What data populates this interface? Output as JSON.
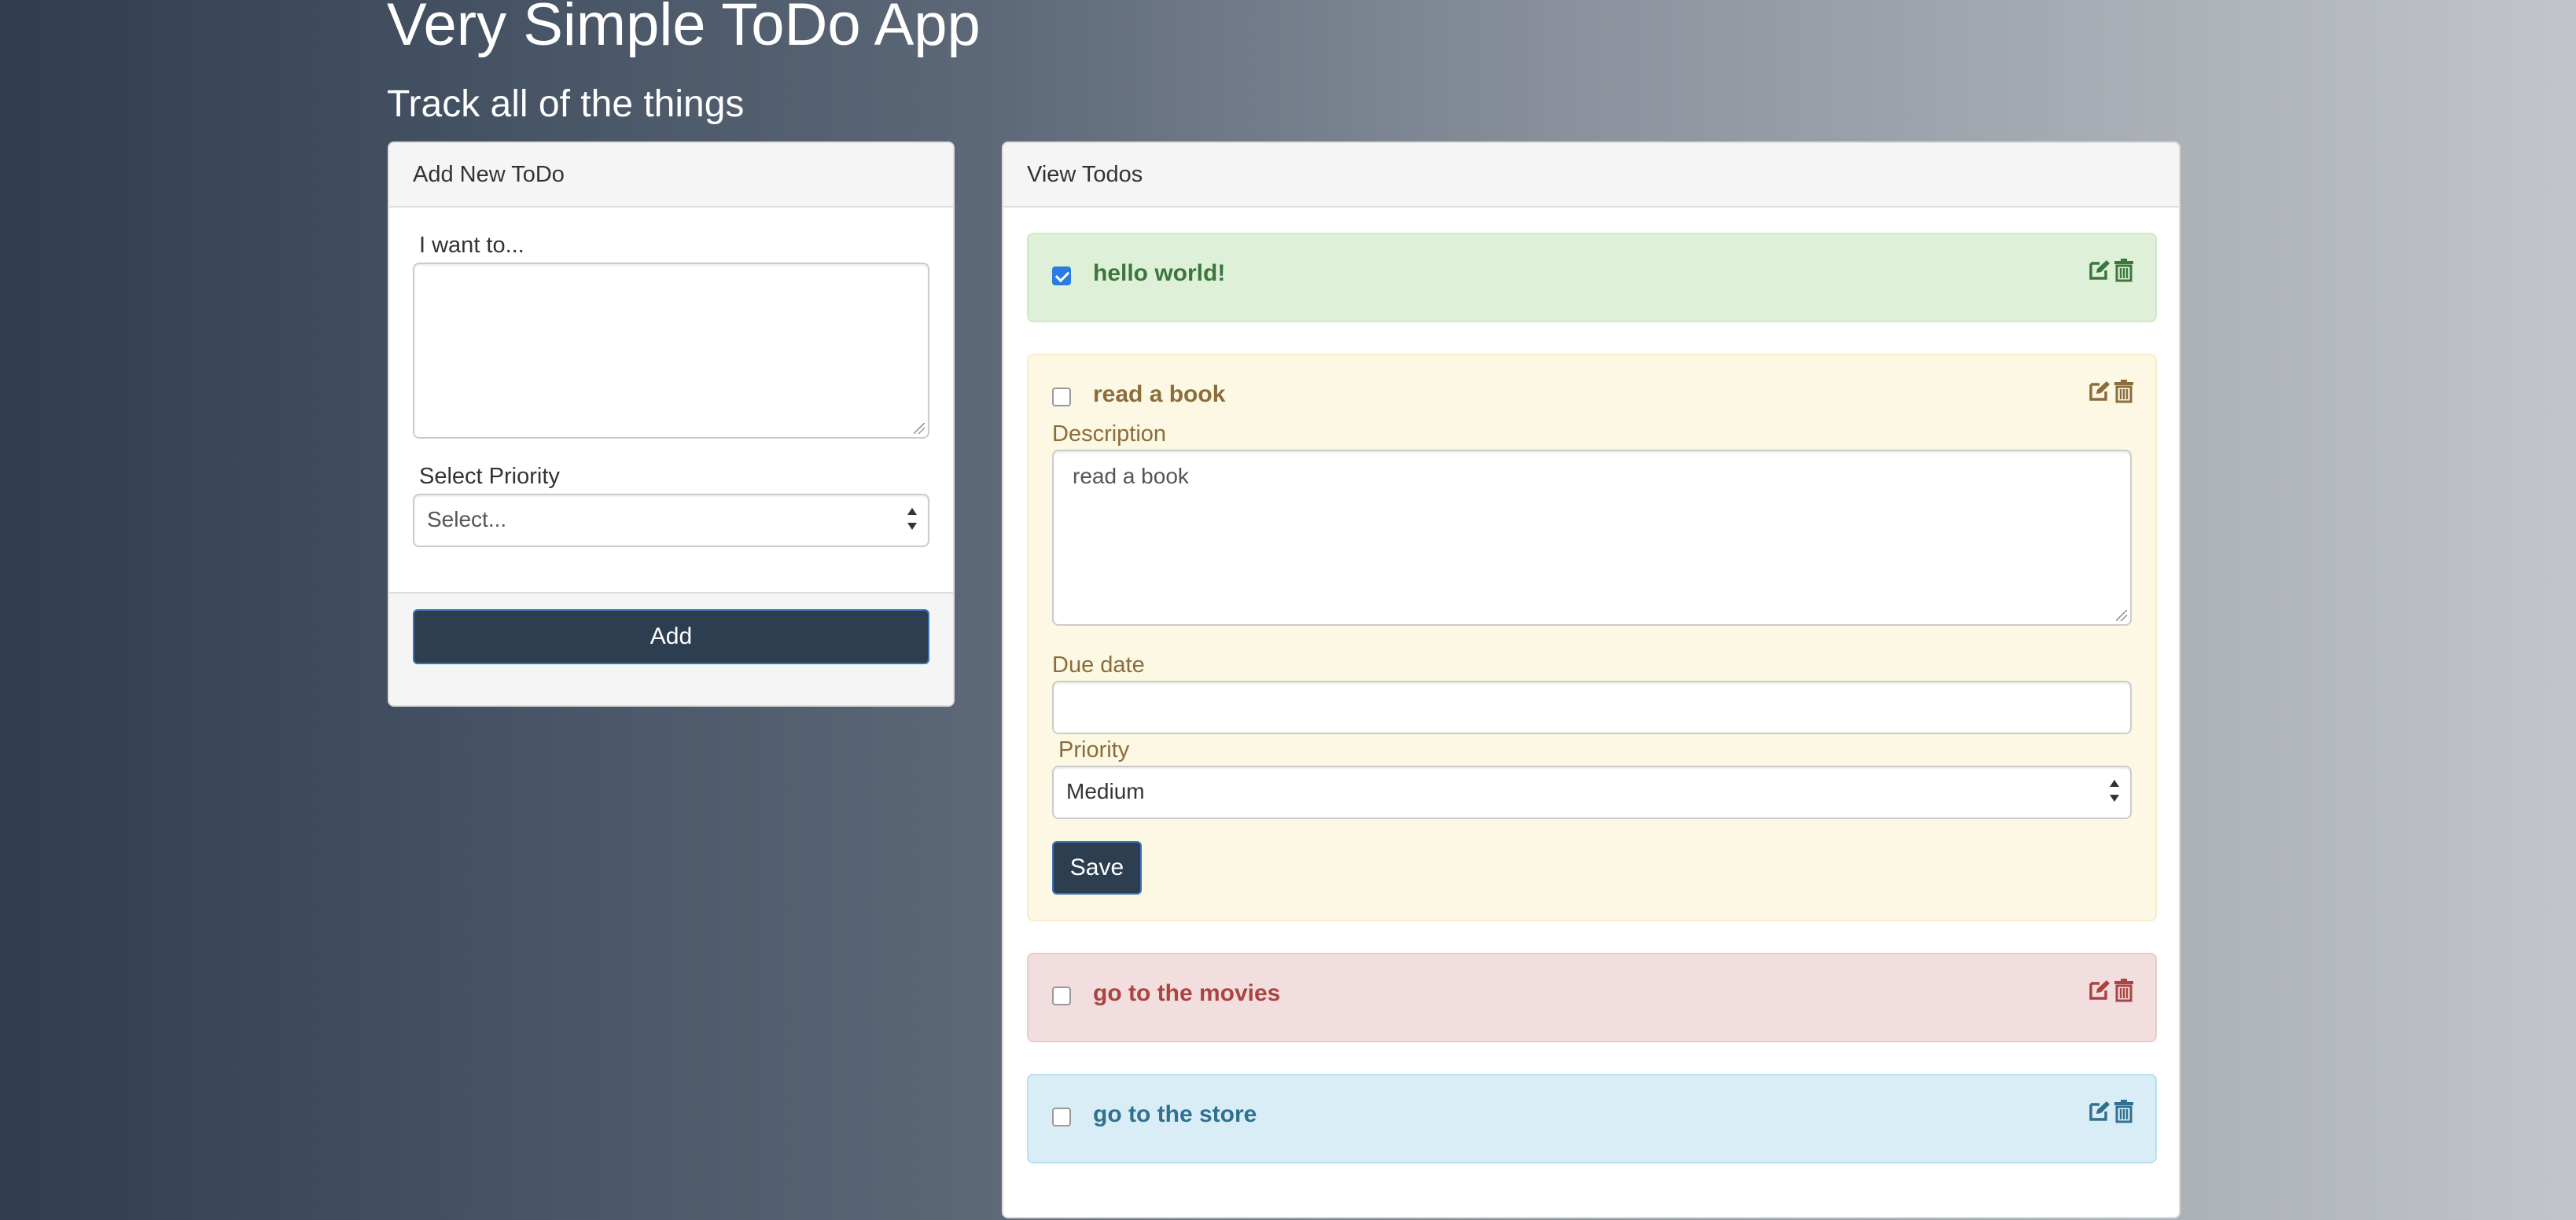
{
  "app": {
    "title": "Very Simple ToDo App",
    "subtitle": "Track all of the things"
  },
  "add_panel": {
    "heading": "Add New ToDo",
    "todo_label": "I want to...",
    "todo_value": "",
    "priority_label": "Select Priority",
    "priority_selected": "Select...",
    "add_button": "Add"
  },
  "view_panel": {
    "heading": "View Todos",
    "todos": [
      {
        "title": "hello world!",
        "completed": true,
        "state": "success"
      },
      {
        "title": "read a book",
        "completed": false,
        "state": "warning",
        "expanded": true,
        "description_label": "Description",
        "description_value": "read a book",
        "due_date_label": "Due date",
        "due_date_value": "",
        "priority_label": "Priority",
        "priority_value": "Medium",
        "save_button": "Save"
      },
      {
        "title": "go to the movies",
        "completed": false,
        "state": "danger"
      },
      {
        "title": "go to the store",
        "completed": false,
        "state": "info"
      }
    ]
  },
  "icons": {
    "edit": "edit-icon",
    "delete": "trash-icon"
  },
  "colors": {
    "primary_button": "#2c3e50",
    "success": "#3c763d",
    "warning": "#8a6d3b",
    "danger": "#a94442",
    "info": "#31708f"
  }
}
